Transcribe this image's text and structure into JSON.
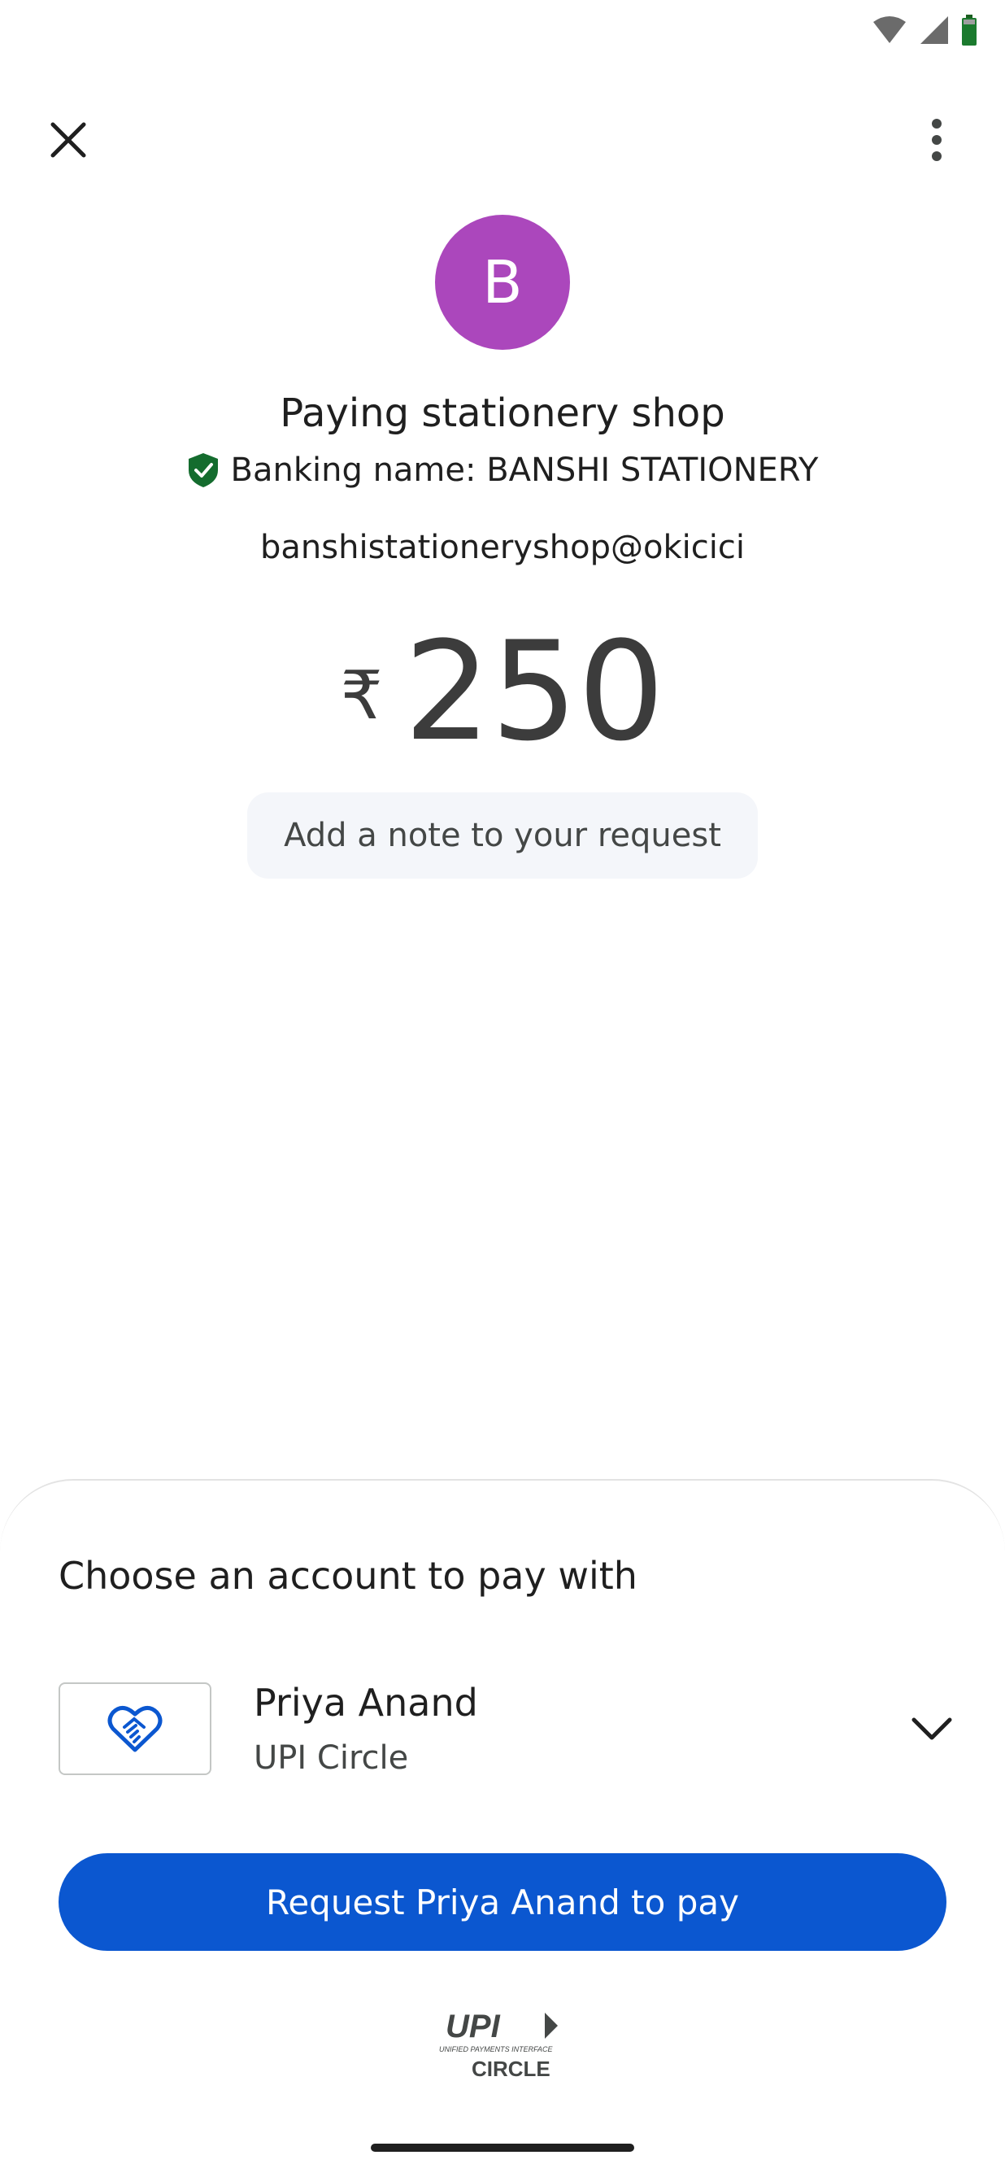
{
  "header": {
    "close_icon": "close-icon",
    "menu_icon": "more-vert-icon"
  },
  "payee": {
    "avatar_initial": "B",
    "avatar_color": "#ab47bc",
    "title": "Paying stationery shop",
    "banking_name": "Banking name: BANSHI STATIONERY",
    "verified_icon": "verified-shield-icon",
    "verified_color": "#146c2e",
    "upi_id": "banshistationeryshop@okicici"
  },
  "amount": {
    "currency_symbol": "₹",
    "value": "250"
  },
  "note": {
    "placeholder": "Add a note to your request"
  },
  "account_sheet": {
    "title": "Choose an account to pay with",
    "account": {
      "name": "Priya Anand",
      "subtitle": "UPI Circle",
      "logo_icon": "upi-circle-handshake-icon"
    },
    "expand_icon": "chevron-down-icon",
    "pay_button_label": "Request Priya Anand to pay",
    "button_color": "#0b57d0"
  },
  "footer": {
    "logo_text": "UPI",
    "logo_subtext": "UNIFIED PAYMENTS INTERFACE",
    "logo_circle": "CIRCLE"
  }
}
